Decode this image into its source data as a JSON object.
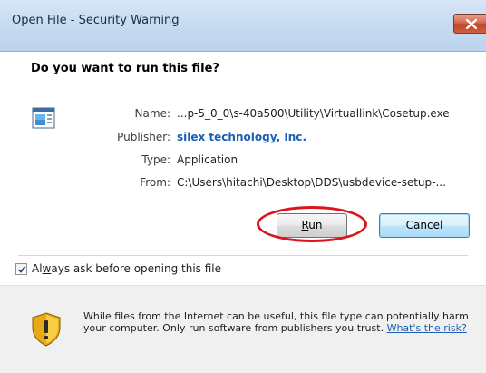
{
  "window": {
    "title": "Open File - Security Warning",
    "close_icon": "close-icon"
  },
  "dialog": {
    "question": "Do you want to run this file?",
    "file_icon": "application-icon",
    "name_label": "Name:",
    "name_value": "...p-5_0_0\\s-40a500\\Utility\\Virtuallink\\Cosetup.exe",
    "publisher_label": "Publisher:",
    "publisher_value": "silex technology, Inc.",
    "type_label": "Type:",
    "type_value": "Application",
    "from_label": "From:",
    "from_value": "C:\\Users\\hitachi\\Desktop\\DDS\\usbdevice-setup-..."
  },
  "buttons": {
    "run_accel": "R",
    "run_rest": "un",
    "cancel_label": "Cancel"
  },
  "option": {
    "checked": true,
    "label_pre": "Al",
    "label_accel": "w",
    "label_post": "ays ask before opening this file"
  },
  "warning": {
    "icon": "shield-warning-icon",
    "text": "While files from the Internet can be useful, this file type can potentially harm your computer. Only run software from publishers you trust.",
    "link_text": "What's the risk?"
  },
  "colors": {
    "highlight_ring": "#d9161c",
    "link": "#1a5fb4",
    "close_button": "#c2432a"
  }
}
